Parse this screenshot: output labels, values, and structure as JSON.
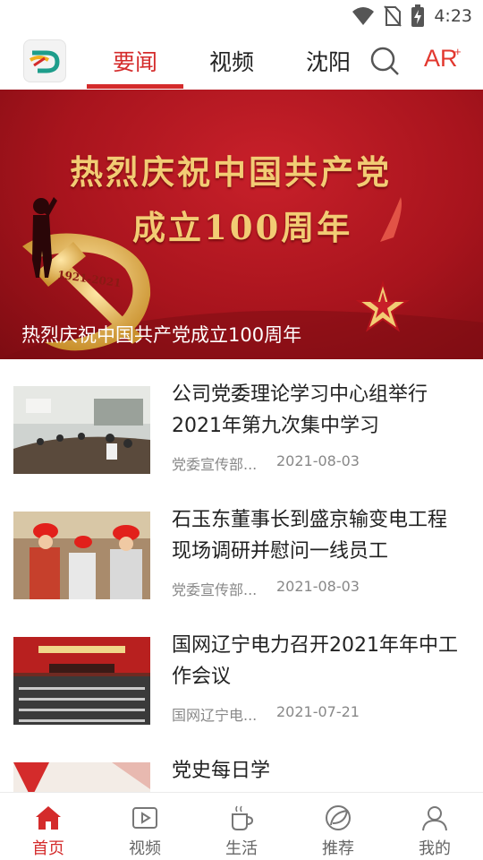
{
  "status_bar": {
    "time": "4:23"
  },
  "top_nav": {
    "tabs": [
      {
        "label": "要闻",
        "active": true
      },
      {
        "label": "视频",
        "active": false
      },
      {
        "label": "沈阳",
        "active": false
      }
    ],
    "ar_label": "AR",
    "ar_superscript": "+"
  },
  "banner": {
    "headline_line1": "热烈庆祝中国共产党",
    "headline_line2": "成立100周年",
    "emblem_years": "1921-2021",
    "caption": "热烈庆祝中国共产党成立100周年"
  },
  "news": [
    {
      "title": "公司党委理论学习中心组举行2021年第九次集中学习",
      "source": "党委宣传部...",
      "date": "2021-08-03"
    },
    {
      "title": "石玉东董事长到盛京输变电工程现场调研并慰问一线员工",
      "source": "党委宣传部...",
      "date": "2021-08-03"
    },
    {
      "title": "国网辽宁电力召开2021年年中工作会议",
      "source": "国网辽宁电...",
      "date": "2021-07-21"
    },
    {
      "title": "党史每日学",
      "source": "",
      "date": ""
    }
  ],
  "bottom_nav": [
    {
      "label": "首页",
      "icon": "home-icon",
      "active": true
    },
    {
      "label": "视频",
      "icon": "play-icon",
      "active": false
    },
    {
      "label": "生活",
      "icon": "cup-icon",
      "active": false
    },
    {
      "label": "推荐",
      "icon": "leaf-icon",
      "active": false
    },
    {
      "label": "我的",
      "icon": "user-icon",
      "active": false
    }
  ],
  "colors": {
    "accent": "#d42b2b",
    "banner_red": "#b3151e",
    "banner_gold": "#f2cc74"
  }
}
